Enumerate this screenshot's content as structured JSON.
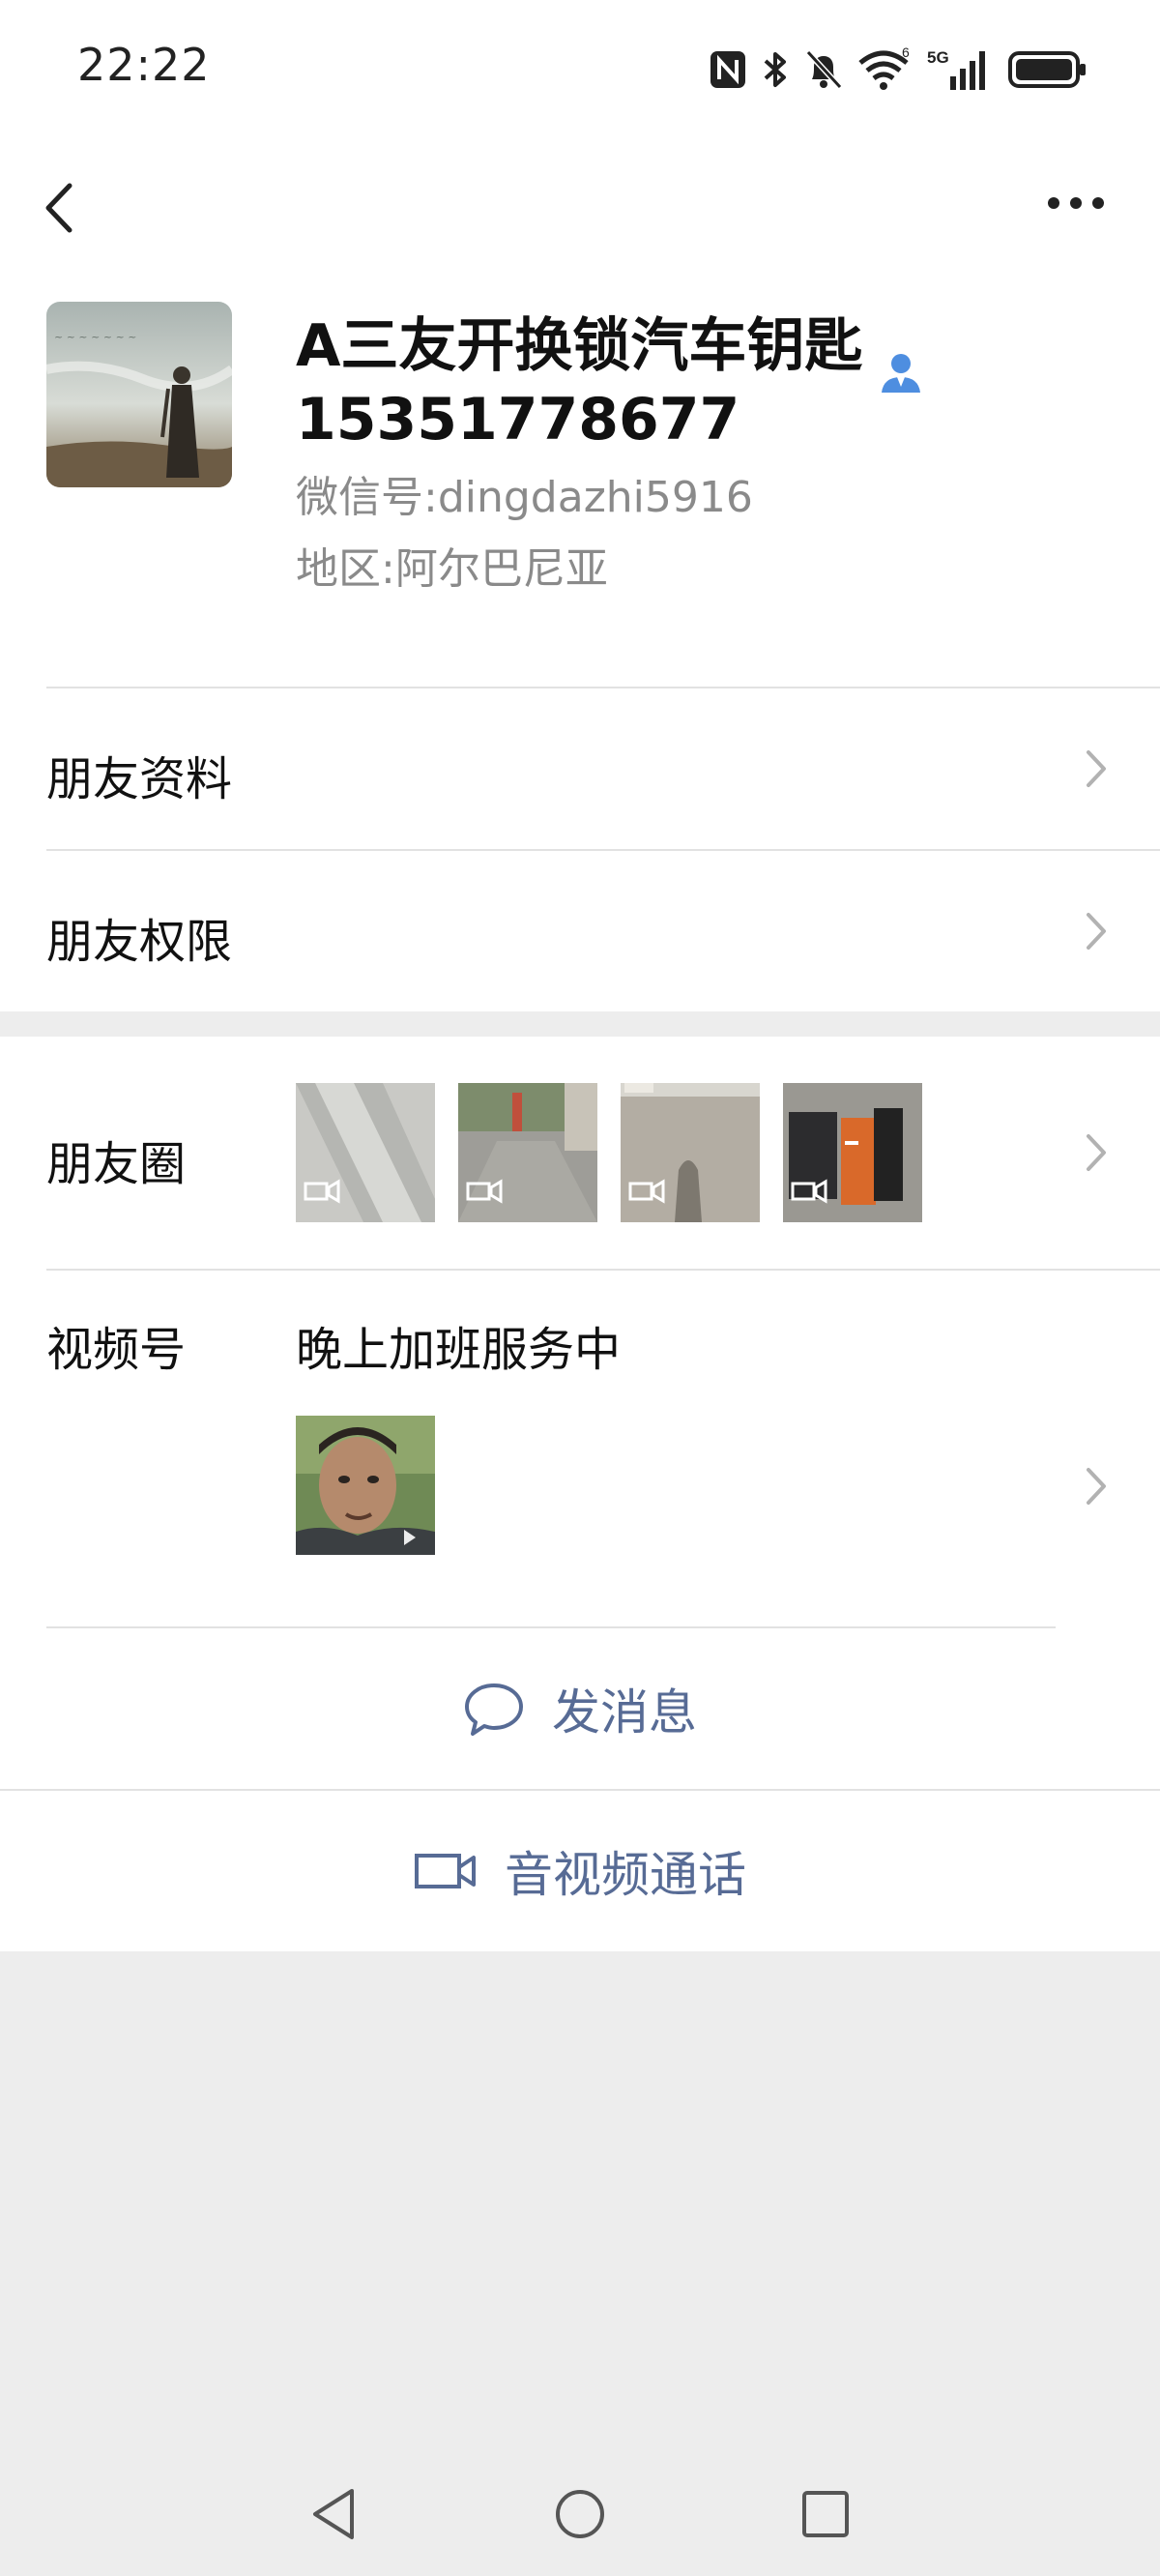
{
  "status_bar": {
    "time": "22:22"
  },
  "profile": {
    "display_name_line1": "A三友开换锁汽车钥匙",
    "display_name_line2": "15351778677",
    "wechat_id_label": "微信号:",
    "wechat_id": "dingdazhi5916",
    "region_label": "地区:",
    "region": "阿尔巴尼亚"
  },
  "menu": {
    "friend_info": "朋友资料",
    "friend_permissions": "朋友权限",
    "moments": "朋友圈",
    "channels": "视频号",
    "channels_title": "晚上加班服务中"
  },
  "actions": {
    "send_message": "发消息",
    "av_call": "音视频通话"
  },
  "colors": {
    "link_blue": "#576b95",
    "background": "#ededed",
    "card": "#ffffff"
  },
  "icons": {
    "back": "chevron-left-icon",
    "more": "more-dots-icon",
    "verified": "person-icon",
    "message": "chat-bubble-icon",
    "video": "video-camera-icon"
  }
}
